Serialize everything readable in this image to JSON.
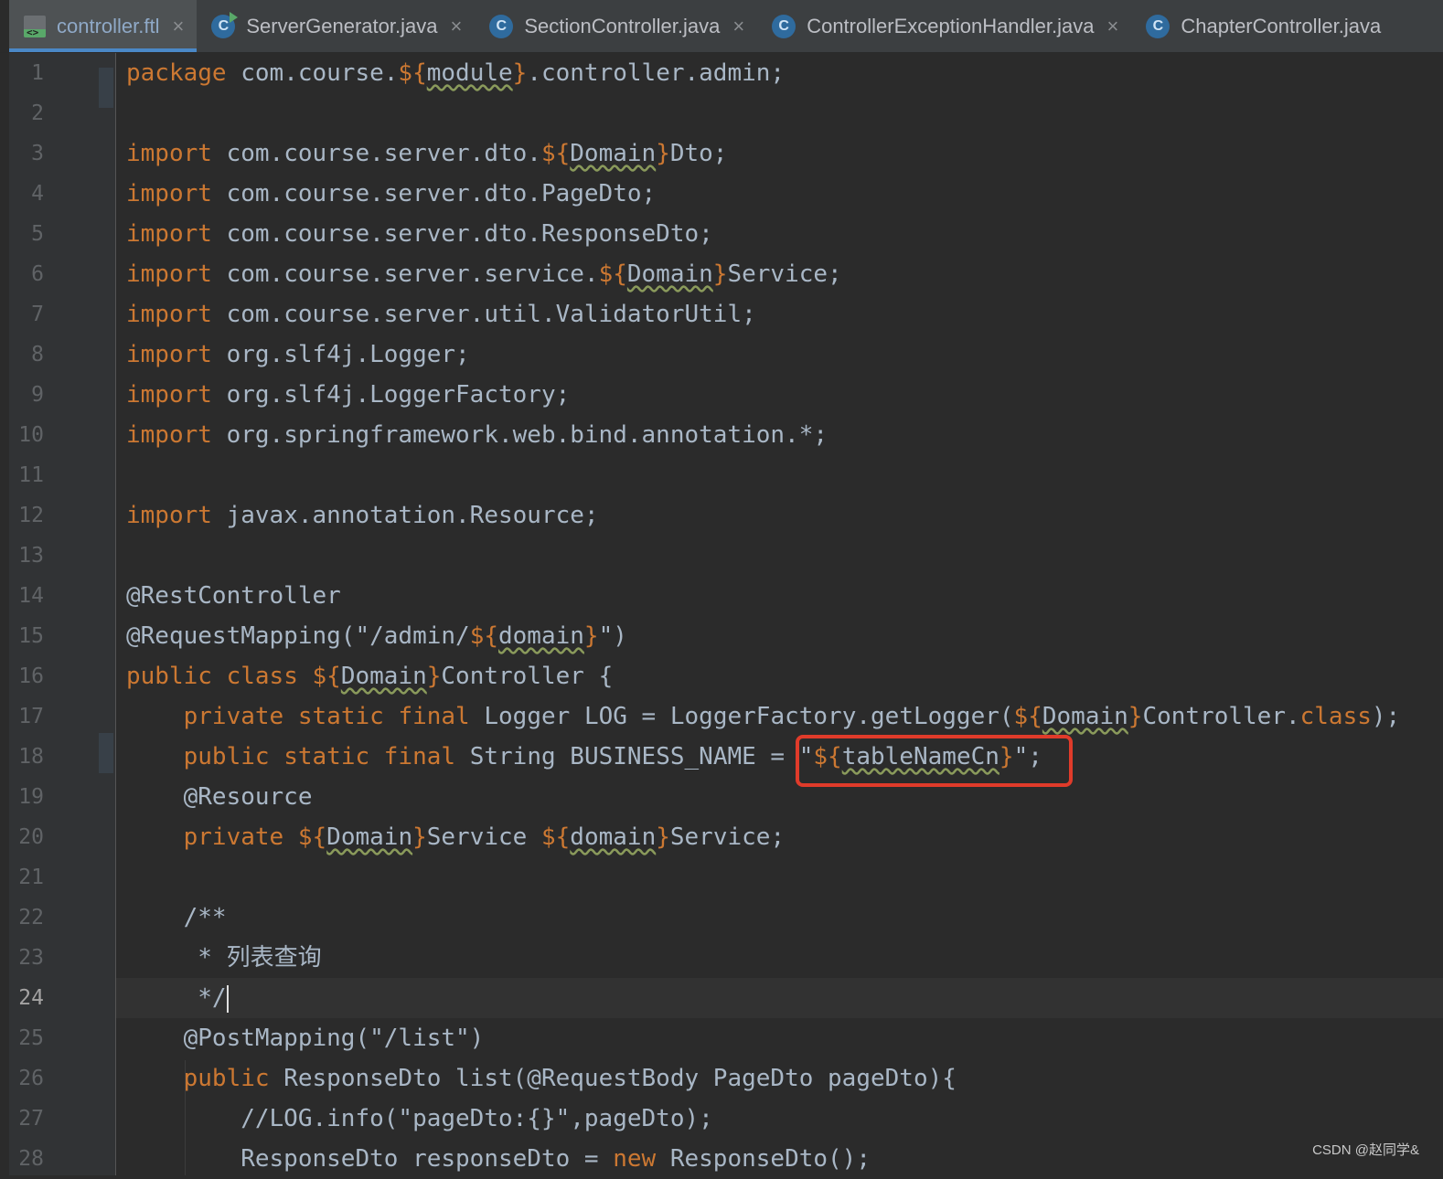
{
  "tabs": [
    {
      "label": "controller.ftl",
      "icon": "ftl-file-icon",
      "active": true
    },
    {
      "label": "ServerGenerator.java",
      "icon": "java-class-runnable-icon",
      "active": false
    },
    {
      "label": "SectionController.java",
      "icon": "java-class-icon",
      "active": false
    },
    {
      "label": "ControllerExceptionHandler.java",
      "icon": "java-class-icon",
      "active": false
    },
    {
      "label": "ChapterController.java",
      "icon": "java-class-icon",
      "active": false
    }
  ],
  "tab_close_glyph": "×",
  "class_icon_letter": "C",
  "ftl_icon_glyph": "<>",
  "current_line": 24,
  "code_lines": [
    "package com.course.${module}.controller.admin;",
    "",
    "import com.course.server.dto.${Domain}Dto;",
    "import com.course.server.dto.PageDto;",
    "import com.course.server.dto.ResponseDto;",
    "import com.course.server.service.${Domain}Service;",
    "import com.course.server.util.ValidatorUtil;",
    "import org.slf4j.Logger;",
    "import org.slf4j.LoggerFactory;",
    "import org.springframework.web.bind.annotation.*;",
    "",
    "import javax.annotation.Resource;",
    "",
    "@RestController",
    "@RequestMapping(\"/admin/${domain}\")",
    "public class ${Domain}Controller {",
    "    private static final Logger LOG = LoggerFactory.getLogger(${Domain}Controller.class);",
    "    public static final String BUSINESS_NAME = \"${tableNameCn}\";",
    "    @Resource",
    "    private ${Domain}Service ${domain}Service;",
    "",
    "    /**",
    "     * 列表查询",
    "     */",
    "    @PostMapping(\"/list\")",
    "    public ResponseDto list(@RequestBody PageDto pageDto){",
    "        //LOG.info(\"pageDto:{}\",pageDto);",
    "        ResponseDto responseDto = new ResponseDto();"
  ],
  "watermark": "CSDN @赵同学&",
  "colors": {
    "editor_bg": "#2b2b2b",
    "placeholder": "#cc7832",
    "highlight_box": "#e03b2a",
    "active_tab_underline": "#4a88c7"
  }
}
